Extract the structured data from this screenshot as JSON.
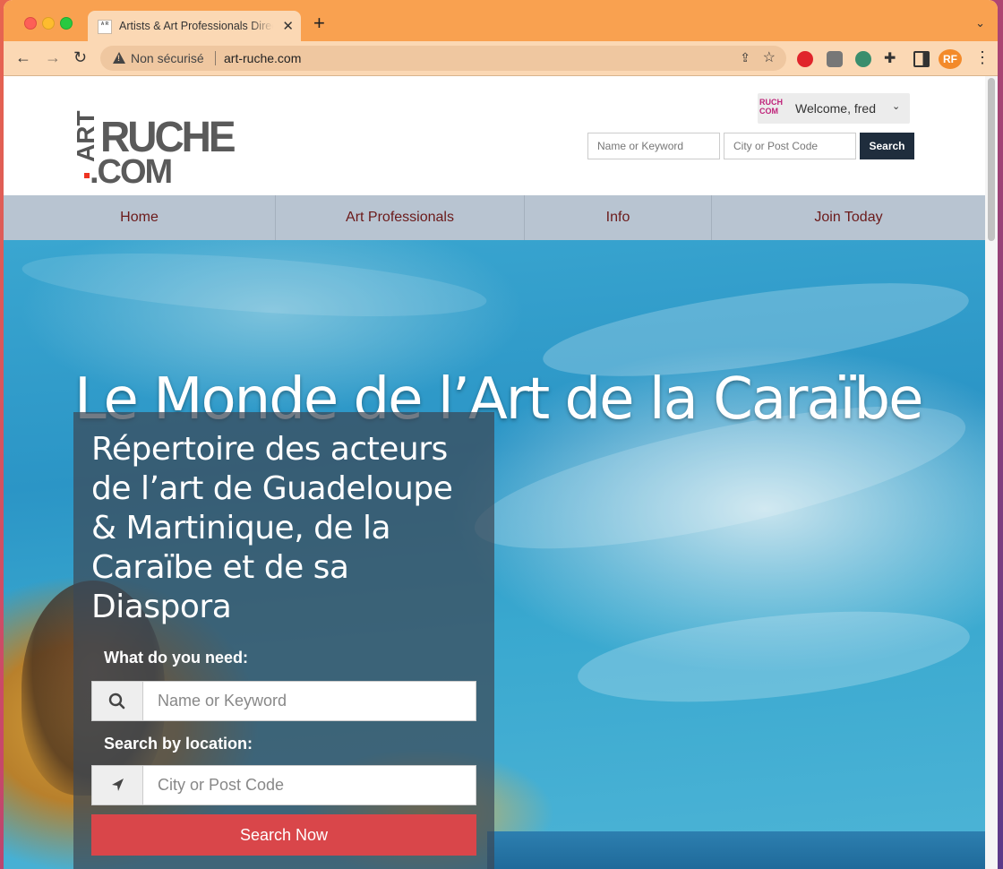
{
  "browser": {
    "tab_title": "Artists & Art Professionals Directory",
    "new_tab_symbol": "+",
    "tab_close_symbol": "✕",
    "security_label": "Non sécurisé",
    "url": "art-ruche.com",
    "tab_bar_color": "#f9a150",
    "toolbar_color": "#fbd8b4"
  },
  "header": {
    "logo": {
      "art": "ART",
      "ruche": "RUCHE",
      "com": ".COM"
    },
    "user_menu": {
      "avatar_text": "RUCH COM",
      "welcome": "Welcome, fred"
    },
    "search": {
      "keyword_placeholder": "Name or Keyword",
      "city_placeholder": "City or Post Code",
      "button_label": "Search"
    }
  },
  "nav": {
    "items": [
      {
        "label": "Home"
      },
      {
        "label": "Art Professionals"
      },
      {
        "label": "Info"
      },
      {
        "label": "Join Today"
      }
    ],
    "text_color": "#6b1a1a",
    "background": "#b8c4d1"
  },
  "hero": {
    "title": "Le Monde de l’Art de la Caraïbe",
    "panel": {
      "heading": "Répertoire des acteurs de l’art de Guadeloupe & Martinique, de la Caraïbe et de sa Diaspora",
      "need_label": "What do you need:",
      "keyword_placeholder": "Name or Keyword",
      "location_label": "Search by location:",
      "city_placeholder": "City or Post Code",
      "button_label": "Search Now",
      "button_color": "#d9464a"
    }
  },
  "icons": [
    "warning-icon",
    "share-icon",
    "star-icon",
    "extensions-icon",
    "search-icon",
    "location-arrow-icon",
    "chevron-down-icon"
  ]
}
